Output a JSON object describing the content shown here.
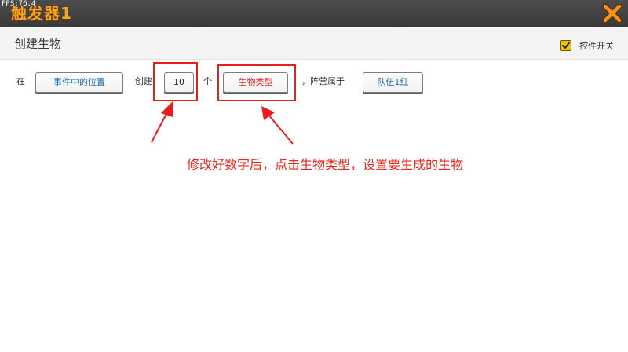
{
  "window": {
    "title": "触发器1",
    "fps_label": "FPS:76.4"
  },
  "panel": {
    "section_title": "创建生物",
    "toggle_label": "控件开关",
    "toggle_checked": true
  },
  "statement": {
    "word_at": "在",
    "location_button": "事件中的位置",
    "word_create": "创建",
    "count_value": "10",
    "word_unit": "个",
    "creature_type_button": "生物类型",
    "word_team": "，阵营属于",
    "team_button": "队伍1红"
  },
  "annotation": {
    "instruction_text": "修改好数字后，点击生物类型，设置要生成的生物",
    "color": "#e8281e"
  },
  "colors": {
    "titlebar": "#3f3f3f",
    "title_orange": "#f7a326",
    "close_orange": "#f39221",
    "checkbox_yellow": "#f1c400",
    "blue_text": "#1f6fb8",
    "red_text": "#e0262b"
  }
}
